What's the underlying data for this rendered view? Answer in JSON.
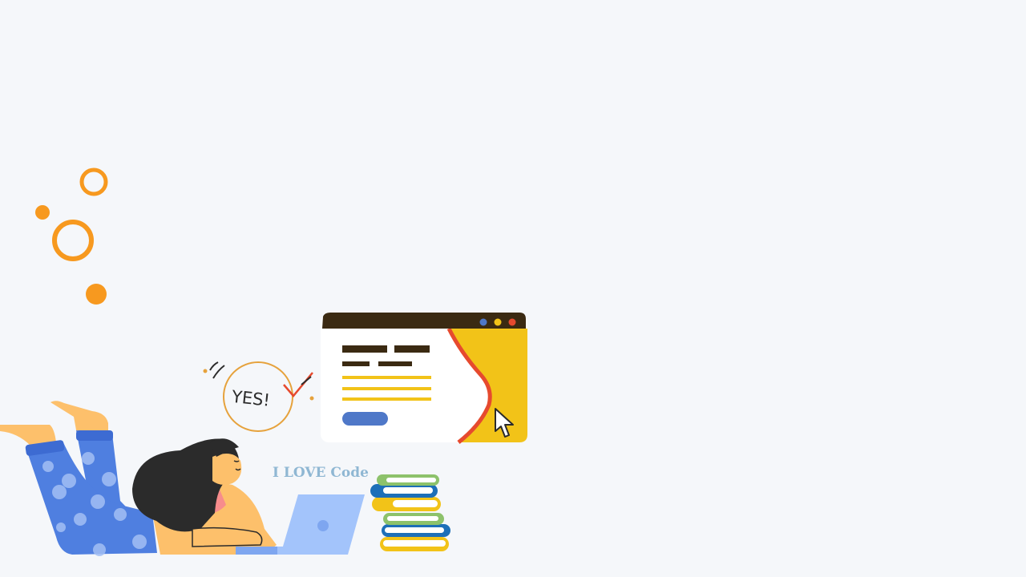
{
  "caption": {
    "text": "I LOVE Code",
    "color": "#8fb7d3"
  },
  "bubble": {
    "text": "YES!"
  },
  "colors": {
    "background": "#f5f7fa",
    "accent_orange": "#f7991f",
    "window_bar": "#3b2a12",
    "window_yellow": "#f2c318",
    "window_red": "#e64a2e",
    "button_blue": "#4f78c8",
    "skin": "#fdc06b",
    "hair": "#2b2b2b",
    "pants": "#4f7fe0",
    "laptop": "#a3c4fb"
  },
  "icons": [
    "decorative-circles",
    "browser-window-illustration",
    "mouse-cursor-icon",
    "yes-bubble-icon",
    "checkmark-icon",
    "book-stack-icon",
    "laptop-icon",
    "girl-illustration"
  ]
}
